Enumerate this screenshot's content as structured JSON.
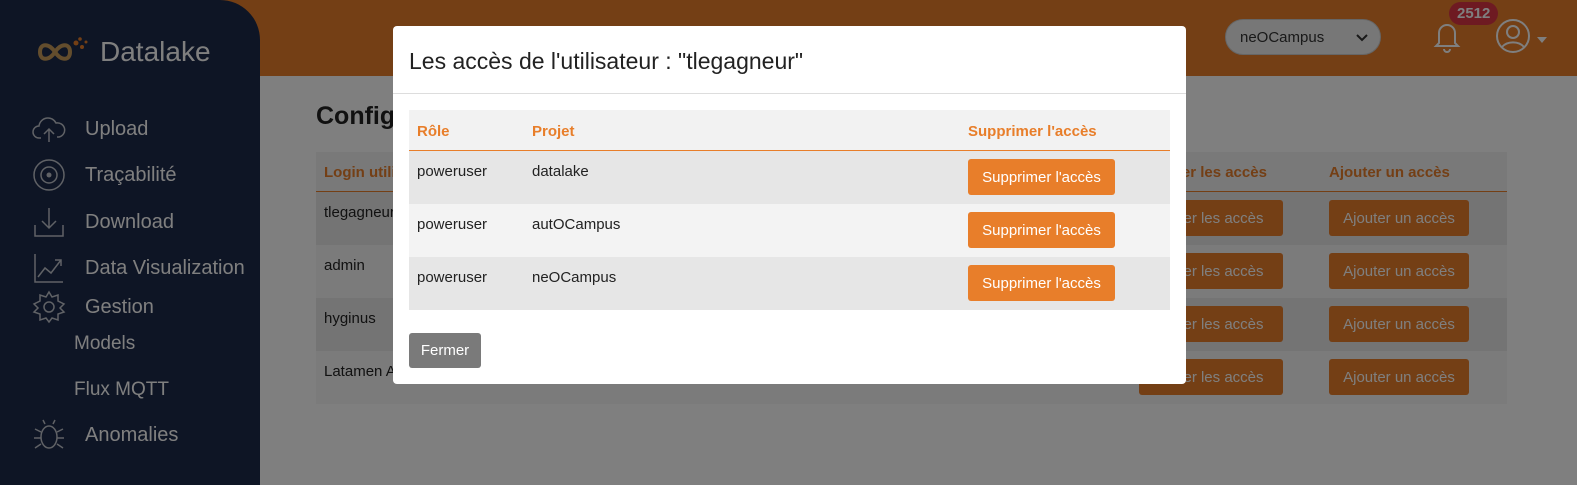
{
  "app": {
    "name": "Datalake"
  },
  "header": {
    "project_selected": "neOCampus",
    "notification_count": "2512"
  },
  "sidebar": {
    "items": [
      {
        "label": "Upload",
        "icon": "cloud-upload-icon"
      },
      {
        "label": "Traçabilité",
        "icon": "target-icon"
      },
      {
        "label": "Download",
        "icon": "download-icon"
      },
      {
        "label": "Data Visualization",
        "icon": "chart-icon"
      },
      {
        "label": "Gestion",
        "icon": "gear-icon"
      }
    ],
    "subitems": [
      {
        "label": "Models"
      },
      {
        "label": "Flux MQTT"
      }
    ],
    "bottom_items": [
      {
        "label": "Anomalies",
        "icon": "bug-icon"
      }
    ]
  },
  "main": {
    "title": "Configuration des utilisateurs",
    "columns": [
      "Login utilisateur",
      "Gérer les accès",
      "Ajouter un accès"
    ],
    "rows": [
      {
        "login": "tlegagneur"
      },
      {
        "login": "admin"
      },
      {
        "login": "hyginus"
      },
      {
        "login": "Latamen A."
      }
    ],
    "manage_btn": "Gérer les accès",
    "add_btn": "Ajouter un accès"
  },
  "modal": {
    "title": "Les accès de l'utilisateur : \"tlegagneur\"",
    "columns": [
      "Rôle",
      "Projet",
      "Supprimer l'accès"
    ],
    "rows": [
      {
        "role": "poweruser",
        "project": "datalake"
      },
      {
        "role": "poweruser",
        "project": "autOCampus"
      },
      {
        "role": "poweruser",
        "project": "neOCampus"
      }
    ],
    "delete_btn": "Supprimer l'accès",
    "close_btn": "Fermer"
  },
  "colors": {
    "accent": "#e87e2a",
    "sidebar": "#1d2a4a",
    "badge": "#dc3545",
    "close_button": "#7a7a7a"
  }
}
